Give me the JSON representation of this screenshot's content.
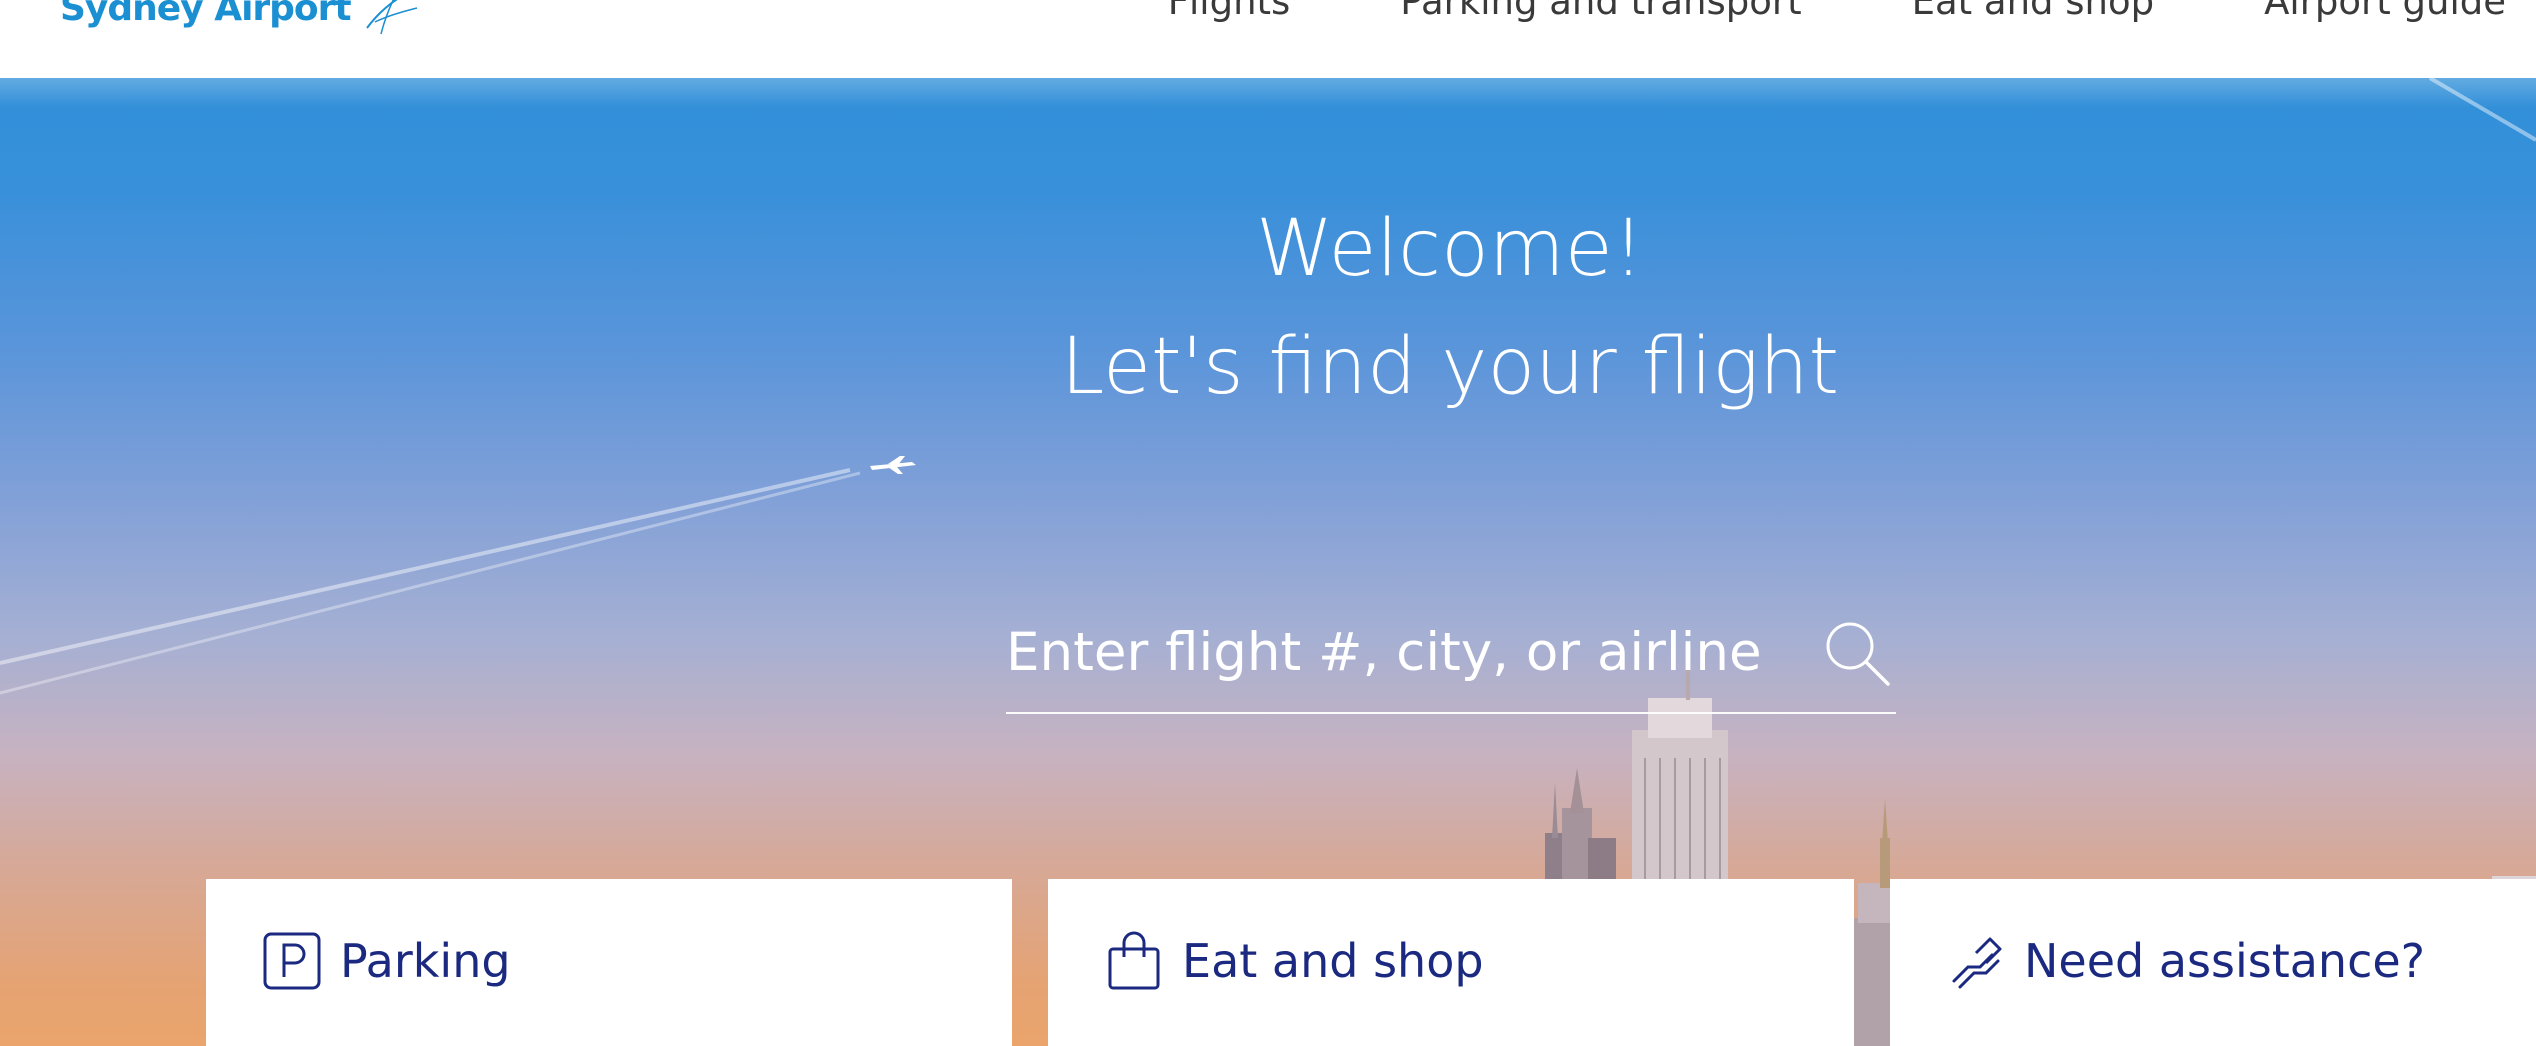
{
  "header": {
    "logo_text": "Sydney Airport",
    "nav": [
      {
        "label": "Flights"
      },
      {
        "label": "Parking and transport"
      },
      {
        "label": "Eat and shop"
      },
      {
        "label": "Airport guide"
      }
    ]
  },
  "hero": {
    "title_line1": "Welcome!",
    "title_line2": "Let's find your flight"
  },
  "search": {
    "placeholder": "Enter flight #, city, or airline",
    "icon": "search-icon"
  },
  "cards": [
    {
      "label": "Parking",
      "icon": "parking-icon"
    },
    {
      "label": "Eat and shop",
      "icon": "shopping-bag-icon"
    },
    {
      "label": "Need assistance?",
      "icon": "helping-hands-icon"
    }
  ],
  "colors": {
    "brand_blue": "#1a8fd1",
    "card_text": "#1b2a80",
    "sky_top": "#2f8fd8",
    "sky_bottom": "#eaa46c"
  }
}
